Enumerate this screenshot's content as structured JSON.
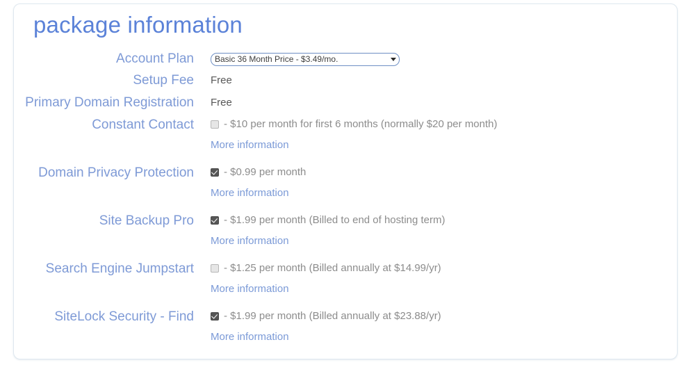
{
  "panel": {
    "title": "package information",
    "accent_color": "#5b82d8",
    "label_color": "#7e9ad6",
    "value_color": "#8c8c8c",
    "link_color": "#7b9ad7",
    "border_color": "#dfe8ef"
  },
  "account_plan": {
    "label": "Account Plan",
    "selected": "Basic 36 Month Price - $3.49/mo.",
    "options": [
      "Basic 36 Month Price - $3.49/mo."
    ]
  },
  "setup_fee": {
    "label": "Setup Fee",
    "value": "Free"
  },
  "primary_domain": {
    "label": "Primary Domain Registration",
    "value": "Free"
  },
  "addons": [
    {
      "label": "Constant Contact",
      "checked": false,
      "price_text": "- $10 per month for first 6 months (normally $20 per month)",
      "more_link": "More information"
    },
    {
      "label": "Domain Privacy Protection",
      "checked": true,
      "price_text": "- $0.99 per month",
      "more_link": "More information"
    },
    {
      "label": "Site Backup Pro",
      "checked": true,
      "price_text": "- $1.99 per month (Billed to end of hosting term)",
      "more_link": "More information"
    },
    {
      "label": "Search Engine Jumpstart",
      "checked": false,
      "price_text": "- $1.25 per month (Billed annually at $14.99/yr)",
      "more_link": "More information"
    },
    {
      "label": "SiteLock Security - Find",
      "checked": true,
      "price_text": "- $1.99 per month (Billed annually at $23.88/yr)",
      "more_link": "More information"
    }
  ]
}
